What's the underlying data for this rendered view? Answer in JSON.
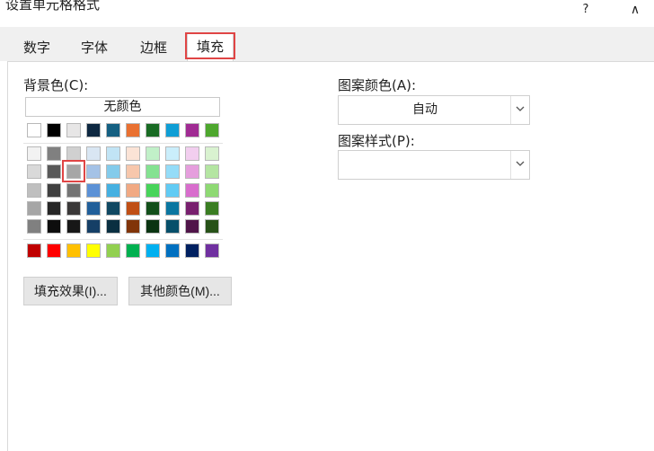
{
  "window": {
    "title": "设置单元格格式",
    "help_label": "?",
    "collapse_label": "∧"
  },
  "tabs": [
    {
      "label": "数字",
      "active": false
    },
    {
      "label": "字体",
      "active": false
    },
    {
      "label": "边框",
      "active": false
    },
    {
      "label": "填充",
      "active": true
    }
  ],
  "fill": {
    "background_label": "背景色(C):",
    "no_color_label": "无颜色",
    "pattern_color_label": "图案颜色(A):",
    "pattern_color_value": "自动",
    "pattern_style_label": "图案样式(P):",
    "pattern_style_value": "",
    "fill_effects_label": "填充效果(I)...",
    "more_colors_label": "其他颜色(M)..."
  },
  "palette": {
    "theme_row": [
      "#ffffff",
      "#000000",
      "#e7e6e6",
      "#0e2841",
      "#156082",
      "#e97132",
      "#196b24",
      "#0f9ed5",
      "#a02b93",
      "#4ea72e"
    ],
    "tint_rows": [
      [
        "#f2f2f2",
        "#808080",
        "#d0d0d0",
        "#d9e6f3",
        "#c1e4f5",
        "#fbe3d6",
        "#c1f0c8",
        "#caeefb",
        "#f2ceef",
        "#d9f2d0"
      ],
      [
        "#d9d9d9",
        "#595959",
        "#a6a6a6",
        "#a4c2e6",
        "#83cbeb",
        "#f7c7ac",
        "#84e291",
        "#94dcf8",
        "#e59edd",
        "#b4e5a2"
      ],
      [
        "#bfbfbf",
        "#404040",
        "#747474",
        "#5b91d6",
        "#45b0e1",
        "#f1a983",
        "#47d45a",
        "#61cbf4",
        "#d86dcd",
        "#8ed973"
      ],
      [
        "#a6a6a6",
        "#262626",
        "#3a3838",
        "#215f9a",
        "#104862",
        "#c04f15",
        "#124f1a",
        "#0b76a0",
        "#78206e",
        "#3a7d22"
      ],
      [
        "#808080",
        "#0d0d0d",
        "#171717",
        "#153f66",
        "#0a2f41",
        "#813409",
        "#0a3411",
        "#074f6a",
        "#501549",
        "#275218"
      ]
    ],
    "standard_row": [
      "#c00000",
      "#ff0000",
      "#ffc000",
      "#ffff00",
      "#92d050",
      "#00b050",
      "#00b0f0",
      "#0070c0",
      "#002060",
      "#7030a0"
    ],
    "selected_color": "#a6a6a6"
  }
}
